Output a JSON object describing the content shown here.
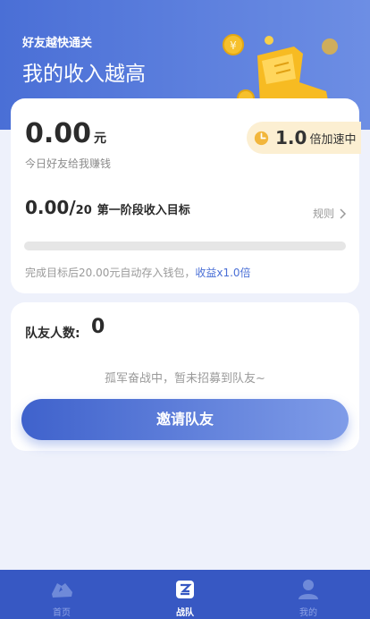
{
  "header": {
    "subtitle": "好友越快通关",
    "title": "我的收入越高"
  },
  "earnings": {
    "amount": "0.00",
    "unit": "元",
    "description": "今日好友给我赚钱"
  },
  "speed_badge": {
    "multiplier": "1.0",
    "label": "倍加速中"
  },
  "goal": {
    "current": "0.00/",
    "total": "20",
    "stage_label": "第一阶段收入目标",
    "rules_label": "规则",
    "progress_fraction": 0,
    "note_prefix": "完成目标后20.00元自动存入钱包，",
    "note_link": "收益x1.0倍"
  },
  "team": {
    "label": "队友人数:",
    "count": "0",
    "empty_message": "孤军奋战中，暂未招募到队友~",
    "invite_button": "邀请队友"
  },
  "tabbar": {
    "items": [
      {
        "label": "首页",
        "icon": "home-shoe-icon",
        "active": false
      },
      {
        "label": "战队",
        "icon": "team-shield-icon",
        "active": true
      },
      {
        "label": "我的",
        "icon": "profile-icon",
        "active": false
      }
    ]
  },
  "colors": {
    "brand_blue": "#4a6fd6",
    "tabbar_bg": "#3758c3",
    "badge_bg": "#fcefd2",
    "page_bg": "#eef1fb"
  }
}
